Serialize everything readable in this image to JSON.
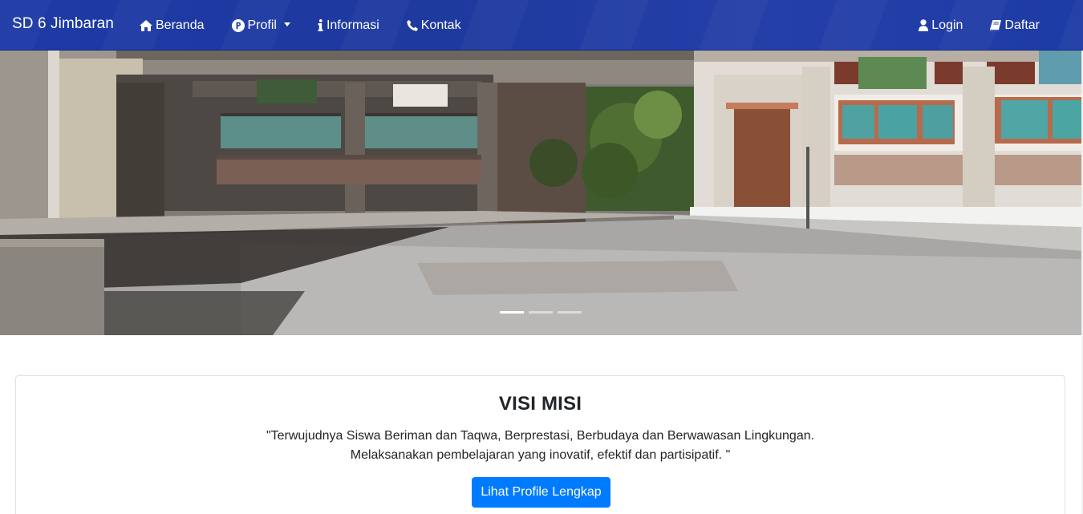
{
  "navbar": {
    "brand": "SD 6 Jimbaran",
    "left_items": [
      {
        "label": "Beranda",
        "icon": "home-icon"
      },
      {
        "label": "Profil",
        "icon": "p-circle-icon",
        "dropdown": true
      },
      {
        "label": "Informasi",
        "icon": "info-icon"
      },
      {
        "label": "Kontak",
        "icon": "phone-icon"
      }
    ],
    "right_items": [
      {
        "label": "Login",
        "icon": "user-icon"
      },
      {
        "label": "Daftar",
        "icon": "book-icon"
      }
    ]
  },
  "carousel": {
    "slide_count": 3,
    "active_index": 0
  },
  "visi_misi": {
    "title": "VISI MISI",
    "line1": "\"Terwujudnya Siswa Beriman dan Taqwa, Berprestasi, Berbudaya dan Berwawasan Lingkungan.",
    "line2": "Melaksanakan pembelajaran yang inovatif, efektif dan partisipatif. \"",
    "button_label": "Lihat Profile Lengkap"
  },
  "colors": {
    "navbar": "#1e3a9e",
    "primary_button": "#007bff"
  }
}
